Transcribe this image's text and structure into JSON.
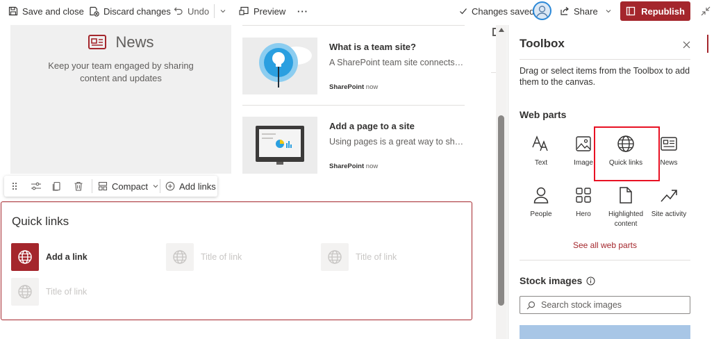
{
  "toolbar": {
    "save_close": "Save and close",
    "discard": "Discard changes",
    "undo": "Undo",
    "preview": "Preview",
    "more": "···",
    "changes_saved": "Changes saved",
    "share": "Share",
    "republish": "Republish"
  },
  "news": {
    "title": "News",
    "description": "Keep your team engaged by sharing content and updates",
    "articles": [
      {
        "title": "What is a team site?",
        "description": "A SharePoint team site connects yo...",
        "source": "SharePoint",
        "time": "now"
      },
      {
        "title": "Add a page to a site",
        "description": "Using pages is a great way to share...",
        "source": "SharePoint",
        "time": "now"
      }
    ]
  },
  "webpart_toolbar": {
    "layout": "Compact",
    "add_links": "Add links"
  },
  "quick_links": {
    "title": "Quick links",
    "add_link": "Add a link",
    "placeholder_links": [
      "Title of link",
      "Title of link",
      "Title of link"
    ]
  },
  "toolbox": {
    "title": "Toolbox",
    "description": "Drag or select items from the Toolbox to add them to the canvas.",
    "web_parts_heading": "Web parts",
    "web_parts": [
      {
        "label": "Text",
        "icon": "text-icon"
      },
      {
        "label": "Image",
        "icon": "image-icon"
      },
      {
        "label": "Quick links",
        "icon": "globe-icon"
      },
      {
        "label": "News",
        "icon": "news-icon"
      },
      {
        "label": "People",
        "icon": "person-icon"
      },
      {
        "label": "Hero",
        "icon": "hero-icon"
      },
      {
        "label": "Highlighted content",
        "icon": "document-icon"
      },
      {
        "label": "Site activity",
        "icon": "trend-icon"
      }
    ],
    "see_all": "See all web parts",
    "stock_images_heading": "Stock images",
    "search_placeholder": "Search stock images"
  },
  "colors": {
    "accent": "#a4262c",
    "highlight_box": "#e81123"
  }
}
